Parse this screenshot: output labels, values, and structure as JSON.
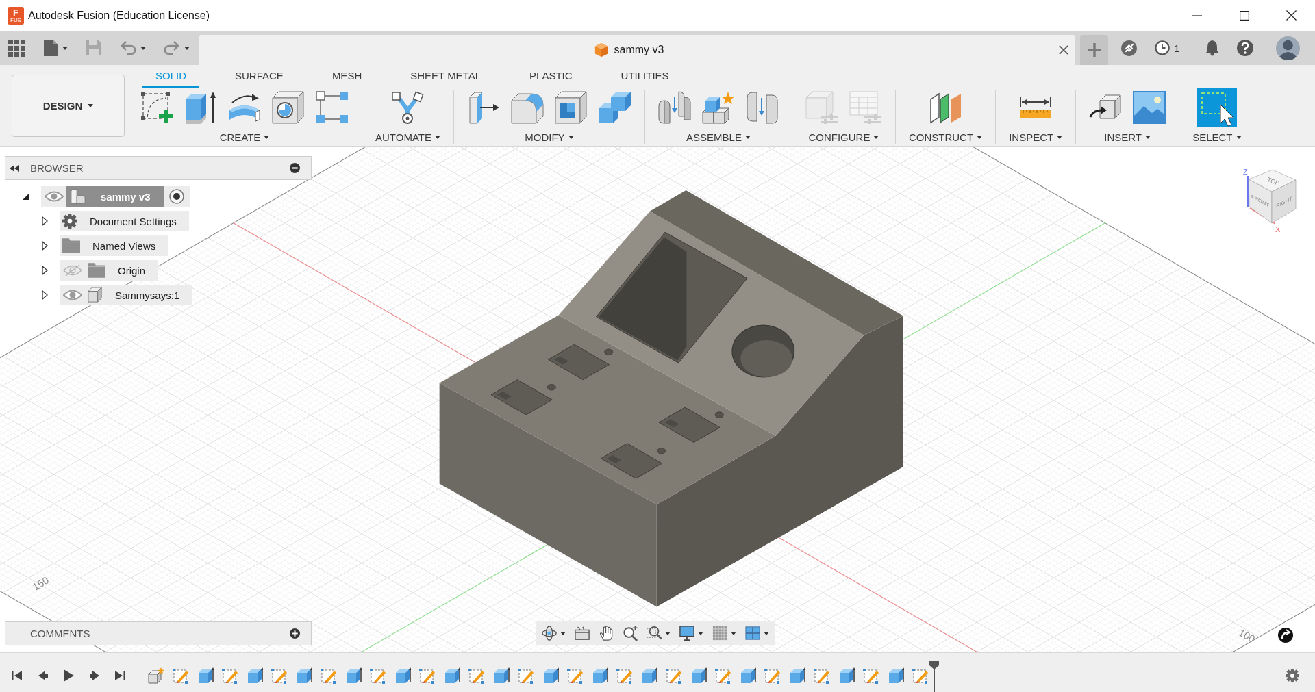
{
  "window": {
    "logo_letter": "F",
    "logo_caption": "FUS",
    "title": "Autodesk Fusion (Education License)"
  },
  "document_tab": {
    "title": "sammy v3"
  },
  "header": {
    "job_count": "1"
  },
  "workspace": {
    "label": "DESIGN"
  },
  "toolbar_tabs": [
    {
      "label": "SOLID",
      "selected": true
    },
    {
      "label": "SURFACE",
      "selected": false
    },
    {
      "label": "MESH",
      "selected": false
    },
    {
      "label": "SHEET METAL",
      "selected": false
    },
    {
      "label": "PLASTIC",
      "selected": false
    },
    {
      "label": "UTILITIES",
      "selected": false
    }
  ],
  "tool_groups": [
    {
      "label": "CREATE",
      "tools": [
        {
          "kind": "sketch",
          "disabled": false
        },
        {
          "kind": "extrude",
          "disabled": false
        },
        {
          "kind": "revolve",
          "disabled": false
        },
        {
          "kind": "hole",
          "disabled": false
        },
        {
          "kind": "pattern",
          "disabled": false
        }
      ]
    },
    {
      "label": "AUTOMATE",
      "tools": [
        {
          "kind": "automate",
          "disabled": false
        }
      ]
    },
    {
      "label": "MODIFY",
      "tools": [
        {
          "kind": "press_pull",
          "disabled": false
        },
        {
          "kind": "fillet",
          "disabled": false
        },
        {
          "kind": "shell",
          "disabled": false
        },
        {
          "kind": "combine",
          "disabled": false
        }
      ]
    },
    {
      "label": "ASSEMBLE",
      "tools": [
        {
          "kind": "joint",
          "disabled": false
        },
        {
          "kind": "component",
          "disabled": false
        },
        {
          "kind": "joint_pair",
          "disabled": false
        }
      ]
    },
    {
      "label": "CONFIGURE",
      "tools": [
        {
          "kind": "parameters",
          "disabled": true
        },
        {
          "kind": "table",
          "disabled": true
        }
      ]
    },
    {
      "label": "CONSTRUCT",
      "tools": [
        {
          "kind": "plane",
          "disabled": false
        }
      ]
    },
    {
      "label": "INSPECT",
      "tools": [
        {
          "kind": "measure",
          "disabled": false
        }
      ]
    },
    {
      "label": "INSERT",
      "tools": [
        {
          "kind": "derive",
          "disabled": false
        },
        {
          "kind": "canvas",
          "disabled": false
        }
      ]
    },
    {
      "label": "SELECT",
      "tools": [
        {
          "kind": "select",
          "disabled": false
        }
      ]
    }
  ],
  "browser": {
    "title": "BROWSER",
    "tree": [
      {
        "label": "sammy v3",
        "kind": "document",
        "selected": true,
        "expanded": true,
        "visible": true,
        "active": true,
        "children": [
          {
            "label": "Document Settings",
            "kind": "settings",
            "selected": false,
            "expanded": false,
            "active": false
          },
          {
            "label": "Named Views",
            "kind": "folder",
            "selected": false,
            "expanded": false,
            "active": false
          },
          {
            "label": "Origin",
            "kind": "folder",
            "selected": false,
            "expanded": false,
            "visible": false,
            "active": false
          },
          {
            "label": "Sammysays:1",
            "kind": "body",
            "selected": false,
            "expanded": false,
            "visible": true,
            "active": false
          }
        ]
      }
    ]
  },
  "viewport": {
    "grid_labels": [
      "150",
      "100"
    ],
    "view_cube": {
      "faces": [
        "TOP",
        "FRONT",
        "RIGHT"
      ],
      "axes": [
        "Z",
        "X"
      ]
    }
  },
  "comments": {
    "title": "COMMENTS"
  },
  "navigation_tools": [
    {
      "kind": "orbit",
      "menu": true
    },
    {
      "kind": "look_at",
      "menu": false
    },
    {
      "kind": "pan",
      "menu": false
    },
    {
      "kind": "zoom",
      "menu": false
    },
    {
      "kind": "fit",
      "menu": true
    },
    {
      "kind": "display",
      "menu": true
    },
    {
      "kind": "grid",
      "menu": true
    },
    {
      "kind": "viewports",
      "menu": true
    }
  ],
  "timeline": {
    "features": [
      {
        "kind": "component"
      },
      {
        "kind": "sketch"
      },
      {
        "kind": "extrude"
      },
      {
        "kind": "sketch"
      },
      {
        "kind": "extrude"
      },
      {
        "kind": "sketch"
      },
      {
        "kind": "extrude"
      },
      {
        "kind": "sketch"
      },
      {
        "kind": "extrude"
      },
      {
        "kind": "sketch"
      },
      {
        "kind": "extrude"
      },
      {
        "kind": "sketch"
      },
      {
        "kind": "extrude"
      },
      {
        "kind": "sketch"
      },
      {
        "kind": "extrude"
      },
      {
        "kind": "sketch"
      },
      {
        "kind": "extrude"
      },
      {
        "kind": "sketch"
      },
      {
        "kind": "extrude"
      },
      {
        "kind": "sketch"
      },
      {
        "kind": "extrude"
      },
      {
        "kind": "sketch"
      },
      {
        "kind": "extrude"
      },
      {
        "kind": "sketch"
      },
      {
        "kind": "extrude"
      },
      {
        "kind": "sketch"
      },
      {
        "kind": "extrude"
      },
      {
        "kind": "sketch"
      },
      {
        "kind": "extrude"
      },
      {
        "kind": "sketch"
      },
      {
        "kind": "extrude"
      },
      {
        "kind": "sketch"
      }
    ]
  }
}
